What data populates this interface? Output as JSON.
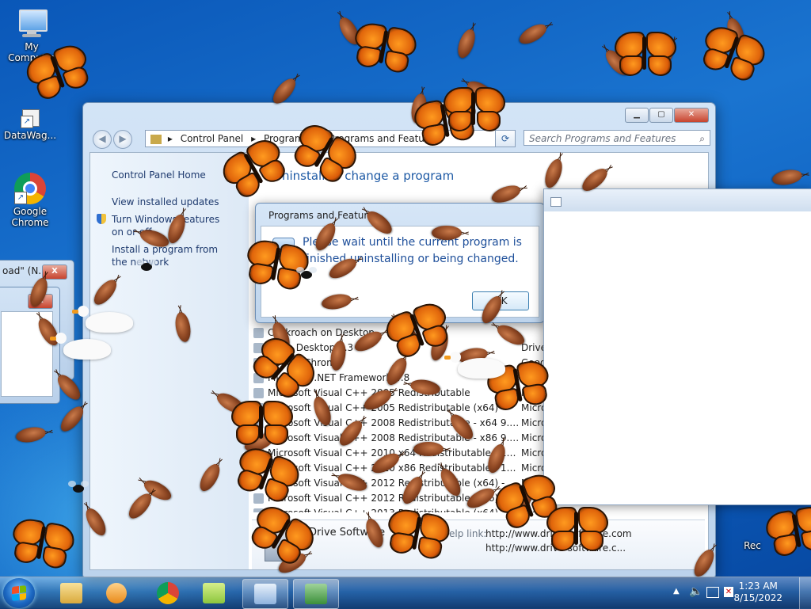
{
  "desktop": {
    "icons": [
      {
        "label": "My Computer"
      },
      {
        "label": "DataWag..."
      },
      {
        "label": "Google Chrome"
      },
      {
        "label": "Rec"
      }
    ]
  },
  "control_panel": {
    "address": {
      "root": "Control Panel",
      "section": "Programs",
      "leaf": "Programs and Features"
    },
    "search_placeholder": "Search Programs and Features",
    "sidebar": {
      "home": "Control Panel Home",
      "updates": "View installed updates",
      "features": "Turn Windows features on or off",
      "network": "Install a program from the network"
    },
    "heading": "Uninstall or change a program",
    "programs": [
      {
        "name": "Cockroach on Desktop",
        "publisher": ""
      },
      {
        "name": "Drive Desktop 1.3",
        "publisher": "Drive Sof"
      },
      {
        "name": "Google Chrome",
        "publisher": "Google L"
      },
      {
        "name": "Microsoft .NET Framework 4.8",
        "publisher": "Microsof"
      },
      {
        "name": "Microsoft Visual C++ 2005 Redistributable",
        "publisher": "Microsof"
      },
      {
        "name": "Microsoft Visual C++ 2005 Redistributable (x64)",
        "publisher": "Microsof"
      },
      {
        "name": "Microsoft Visual C++ 2008 Redistributable - x64 9.0.3...",
        "publisher": "Microsof"
      },
      {
        "name": "Microsoft Visual C++ 2008 Redistributable - x86 9.0.3...",
        "publisher": "Microsof"
      },
      {
        "name": "Microsoft Visual C++ 2010 x64 Redistributable - 10.0...",
        "publisher": "Microsof"
      },
      {
        "name": "Microsoft Visual C++ 2010 x86 Redistributable - 10.0...",
        "publisher": "Microsof"
      },
      {
        "name": "Microsoft Visual C++ 2012 Redistributable (x64) - 11.0...",
        "publisher": "Microsof"
      },
      {
        "name": "Microsoft Visual C++ 2012 Redistributable (x86) - 11.0...",
        "publisher": "Microsof"
      },
      {
        "name": "Microsoft Visual C++ 2013 Redistributable (x64) - 12.0...",
        "publisher": "Microsof"
      }
    ],
    "details": {
      "publisher": "Drive Software",
      "help_label": "Help link:",
      "help_url": "http://www.drive-software.com",
      "support_url": "http://www.drive-software.c..."
    }
  },
  "dialog": {
    "title": "Programs and Features",
    "message": "Please wait until the current program is finished uninstalling or being changed.",
    "ok": "OK"
  },
  "left_windows": {
    "title": "oad\" (N...",
    "close": "X"
  },
  "taskbar": {
    "clock_time": "1:23 AM",
    "clock_date": "8/15/2022"
  },
  "colors": {
    "accent": "#1e5aa5",
    "link": "#1e3a6e"
  }
}
